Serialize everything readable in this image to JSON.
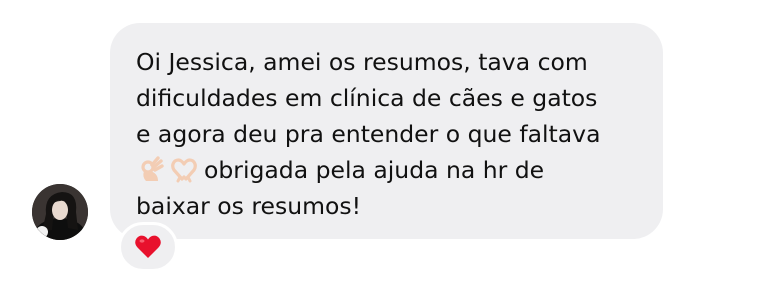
{
  "message": {
    "line1": "Oi Jessica, amei os resumos, tava com",
    "line2": "dificuldades em clínica de cães e gatos",
    "line3": "e agora deu pra entender o que faltava",
    "line4": "obrigada pela ajuda na hr de",
    "line5": "baixar os resumos!",
    "emojis": [
      "ok-hand-icon",
      "heart-hands-icon"
    ]
  },
  "reaction": {
    "icon": "red-heart-icon",
    "color": "#e8112d"
  },
  "colors": {
    "bubble_background": "#efeff1",
    "text": "#111111",
    "page_background": "#ffffff"
  }
}
